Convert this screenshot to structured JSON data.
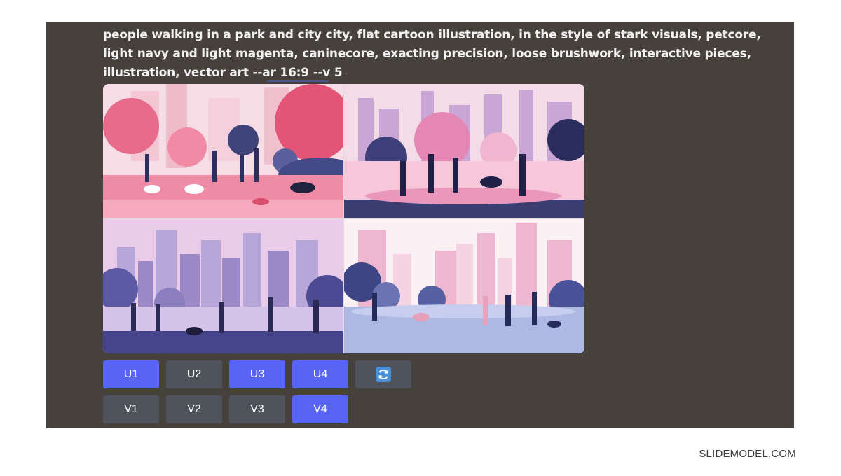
{
  "message": {
    "prompt_text": "people walking in a park and city city, flat cartoon illustration, in the style of stark visuals, petcore, light navy and light magenta, caninecore, exacting precision, loose brushwork, interactive pieces, illustration, vector art --ar 16:9 --v 5",
    "trailing_mark": "·"
  },
  "image_grid": {
    "tiles": [
      {
        "icon": "park-illustration-pink"
      },
      {
        "icon": "park-illustration-navy"
      },
      {
        "icon": "city-illustration-purple"
      },
      {
        "icon": "city-illustration-plaza"
      }
    ]
  },
  "buttons": {
    "upscale": [
      {
        "label": "U1",
        "active": true
      },
      {
        "label": "U2",
        "active": false
      },
      {
        "label": "U3",
        "active": true
      },
      {
        "label": "U4",
        "active": true
      }
    ],
    "reroll": {
      "icon": "refresh-icon",
      "active": false
    },
    "variation": [
      {
        "label": "V1",
        "active": false
      },
      {
        "label": "V2",
        "active": false
      },
      {
        "label": "V3",
        "active": false
      },
      {
        "label": "V4",
        "active": true
      }
    ]
  },
  "colors": {
    "panel_bg": "#46413a",
    "button_active": "#5865f2",
    "button_idle": "#4f545c"
  },
  "footer": {
    "brand": "SLIDEMODEL.COM"
  }
}
